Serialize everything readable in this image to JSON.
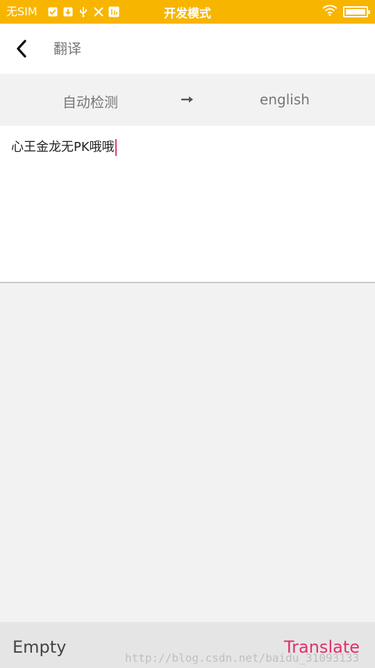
{
  "status_bar": {
    "sim": "无SIM",
    "mode": "开发模式",
    "battery_level": 1.0
  },
  "header": {
    "title": "翻译"
  },
  "language_bar": {
    "source": "自动检测",
    "target": "english"
  },
  "input": {
    "text": "心王金龙无PK哦哦"
  },
  "bottom_bar": {
    "empty_label": "Empty",
    "translate_label": "Translate"
  },
  "watermark": "http://blog.csdn.net/baidu_31093133",
  "colors": {
    "status_bar": "#f8b500",
    "accent": "#e0306a"
  }
}
